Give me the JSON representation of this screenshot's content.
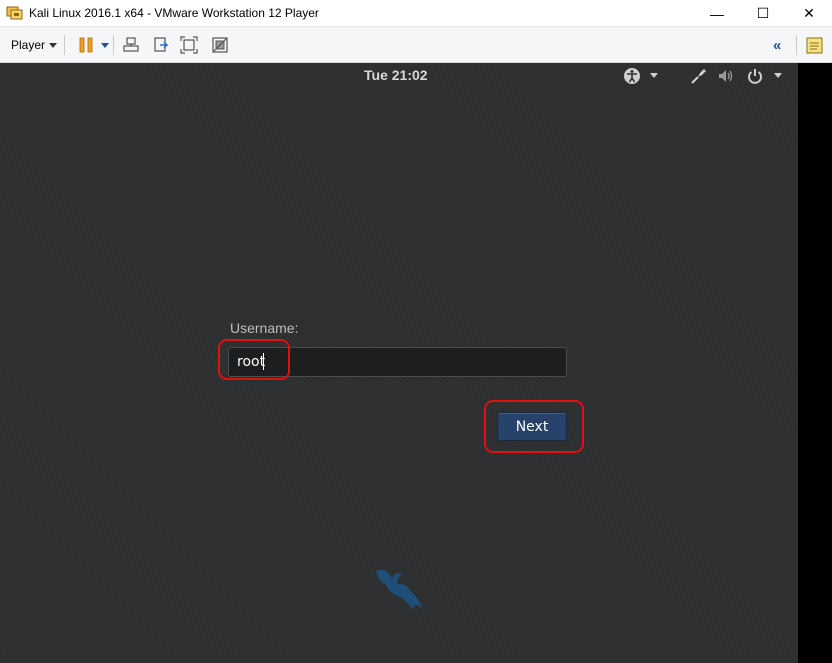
{
  "window": {
    "title": "Kali Linux 2016.1 x64 - VMware Workstation 12 Player",
    "minimize_glyph": "—",
    "maximize_glyph": "☐",
    "close_glyph": "✕"
  },
  "toolbar": {
    "player_label": "Player",
    "collapse_glyph": "«",
    "icons": [
      "pause-icon",
      "send-ctrl-alt-del-icon",
      "removable-devices-icon",
      "fullscreen-icon",
      "unity-icon",
      "library-icon"
    ]
  },
  "topbar": {
    "clock": "Tue 21:02",
    "icons": [
      "accessibility-icon",
      "network-icon",
      "volume-icon",
      "power-icon"
    ]
  },
  "login": {
    "username_label": "Username:",
    "username_value": "root",
    "next_label": "Next"
  },
  "colors": {
    "vm_background": "#2d2f30",
    "next_button": "#27426a",
    "highlight": "#e01010",
    "logo": "#1d4f78"
  }
}
